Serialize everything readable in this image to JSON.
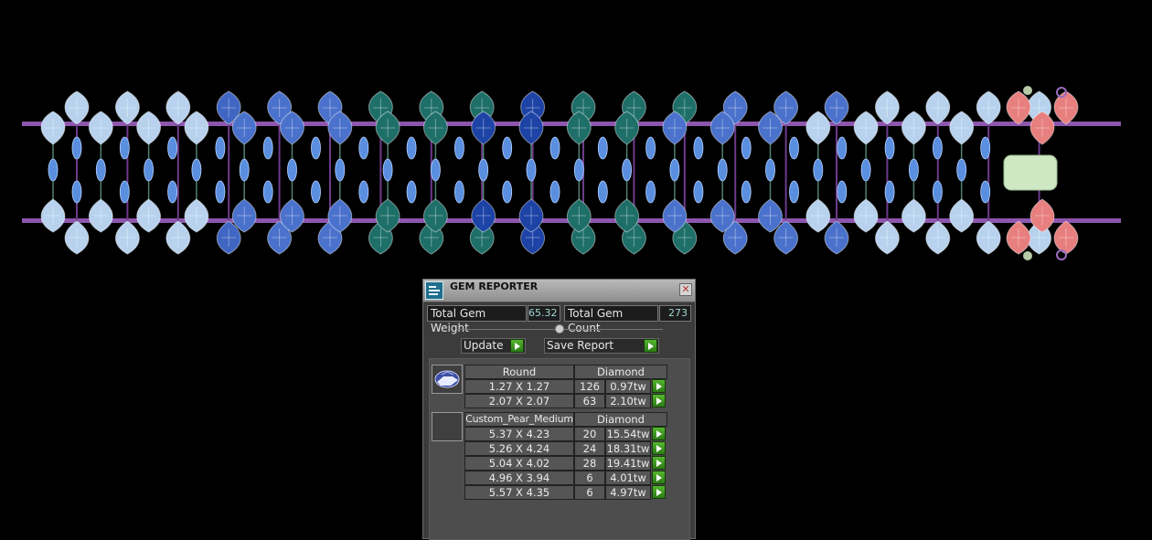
{
  "gem_reporter": {
    "title": "GEM REPORTER",
    "close_symbol": "✕",
    "total_weight_label": "Total Gem Weight",
    "total_weight_value": "65.32",
    "total_count_label": "Total Gem Count",
    "total_count_value": "273",
    "update_label": "Update",
    "save_report_label": "Save Report",
    "groups": [
      {
        "shape": "Round",
        "material": "Diamond",
        "rows": [
          {
            "size": "1.27 X 1.27",
            "count": "126",
            "weight": "0.97tw"
          },
          {
            "size": "2.07 X 2.07",
            "count": "63",
            "weight": "2.10tw"
          }
        ]
      },
      {
        "shape": "Custom_Pear_Medium",
        "material": "Diamond",
        "rows": [
          {
            "size": "5.37 X 4.23",
            "count": "20",
            "weight": "15.54tw"
          },
          {
            "size": "5.26 X 4.24",
            "count": "24",
            "weight": "18.31tw"
          },
          {
            "size": "5.04 X 4.02",
            "count": "28",
            "weight": "19.41tw"
          },
          {
            "size": "4.96 X 3.94",
            "count": "6",
            "weight": "4.01tw"
          },
          {
            "size": "5.57 X 4.35",
            "count": "6",
            "weight": "4.97tw"
          }
        ]
      }
    ]
  },
  "bracelet": {
    "top_pear_colors": [
      "#b8d2ee",
      "#b8d2ee",
      "#b8d2ee",
      "#3f66c2",
      "#4a72cc",
      "#4a72cc",
      "#1f6f69",
      "#1f6f69",
      "#1f6f69",
      "#1d43a6",
      "#1f6f69",
      "#1f6f69",
      "#1f6f69",
      "#4a72cc",
      "#4a72cc",
      "#4a72cc",
      "#b8d2ee",
      "#b8d2ee",
      "#b8d2ee",
      "#b8d2ee"
    ],
    "middle_pear_colors": [
      "#b8d2ee",
      "#b8d2ee",
      "#b8d2ee",
      "#b8d2ee",
      "#4a72cc",
      "#4a72cc",
      "#4a72cc",
      "#1f6f69",
      "#1f6f69",
      "#1d43a6",
      "#1d43a6",
      "#1f6f69",
      "#1f6f69",
      "#4a72cc",
      "#4a72cc",
      "#4a72cc",
      "#b8d2ee",
      "#b8d2ee",
      "#b8d2ee",
      "#b8d2ee"
    ],
    "clasp_color": "#e87f7f",
    "rail_color": "#8d56ad",
    "accent_color": "#5a8fe0"
  }
}
